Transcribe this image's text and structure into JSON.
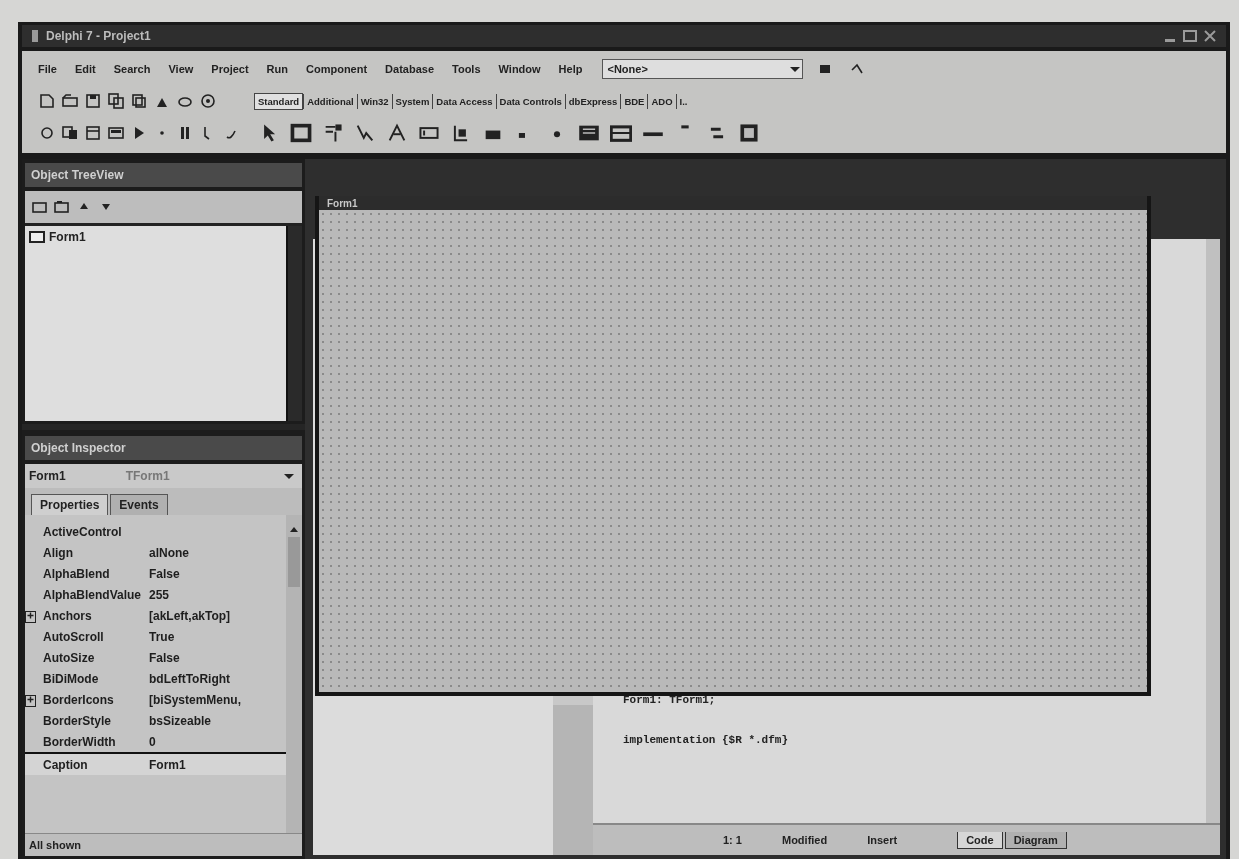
{
  "window": {
    "title": "Delphi 7 - Project1"
  },
  "menu": [
    "File",
    "Edit",
    "Search",
    "View",
    "Project",
    "Run",
    "Component",
    "Database",
    "Tools",
    "Window",
    "Help"
  ],
  "desktop_combo": {
    "value": "<None>"
  },
  "palette_tabs": [
    {
      "label": "Standard",
      "selected": true
    },
    {
      "label": "Additional",
      "selected": false
    },
    {
      "label": "Win32",
      "selected": false
    },
    {
      "label": "System",
      "selected": false
    },
    {
      "label": "Data Access",
      "selected": false
    },
    {
      "label": "Data Controls",
      "selected": false
    },
    {
      "label": "dbExpress",
      "selected": false
    },
    {
      "label": "BDE",
      "selected": false
    },
    {
      "label": "ADO",
      "selected": false
    },
    {
      "label": "I..",
      "selected": false
    }
  ],
  "tree_view": {
    "title": "Object TreeView",
    "items": [
      {
        "label": "Form1"
      }
    ]
  },
  "inspector": {
    "title": "Object Inspector",
    "object": "Form1",
    "object_type": "TForm1",
    "tabs": [
      {
        "label": "Properties",
        "selected": true
      },
      {
        "label": "Events",
        "selected": false
      }
    ],
    "rows": [
      {
        "name": "ActiveControl",
        "value": "",
        "kind": "plain",
        "selected": false
      },
      {
        "name": "Align",
        "value": "alNone",
        "kind": "plain",
        "selected": false
      },
      {
        "name": "AlphaBlend",
        "value": "False",
        "kind": "plain",
        "selected": false
      },
      {
        "name": "AlphaBlendValue",
        "value": "255",
        "kind": "plain",
        "selected": false
      },
      {
        "name": "Anchors",
        "value": "[akLeft,akTop]",
        "kind": "expandable",
        "expanded": false,
        "selected": false
      },
      {
        "name": "AutoScroll",
        "value": "True",
        "kind": "plain",
        "selected": false
      },
      {
        "name": "AutoSize",
        "value": "False",
        "kind": "plain",
        "selected": false
      },
      {
        "name": "BiDiMode",
        "value": "bdLeftToRight",
        "kind": "plain",
        "selected": false
      },
      {
        "name": "BorderIcons",
        "value": "[biSystemMenu,",
        "kind": "expandable",
        "expanded": false,
        "selected": false
      },
      {
        "name": "BorderStyle",
        "value": "bsSizeable",
        "kind": "plain",
        "selected": false
      },
      {
        "name": "BorderWidth",
        "value": "0",
        "kind": "plain",
        "selected": false
      },
      {
        "name": "Caption",
        "value": "Form1",
        "kind": "plain",
        "selected": true
      }
    ],
    "status": "All shown"
  },
  "form_designer": {
    "title": "Form1"
  },
  "editor": {
    "lines": [
      "Form1: TForm1;",
      "implementation {$R *.dfm}"
    ],
    "status": [
      "1: 1",
      "Modified",
      "Insert"
    ],
    "tabs": [
      {
        "label": "Code",
        "selected": true
      },
      {
        "label": "Diagram",
        "selected": false
      }
    ]
  }
}
